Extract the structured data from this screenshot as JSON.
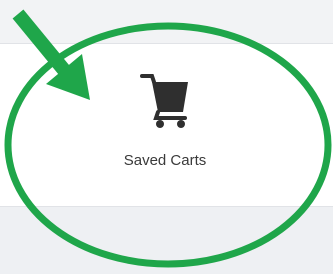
{
  "tile": {
    "label": "Saved Carts",
    "icon": "shopping-cart-icon"
  },
  "annotation": {
    "color": "#1fa64a",
    "arrow_icon": "arrow-down-right",
    "highlight_shape": "ellipse"
  }
}
